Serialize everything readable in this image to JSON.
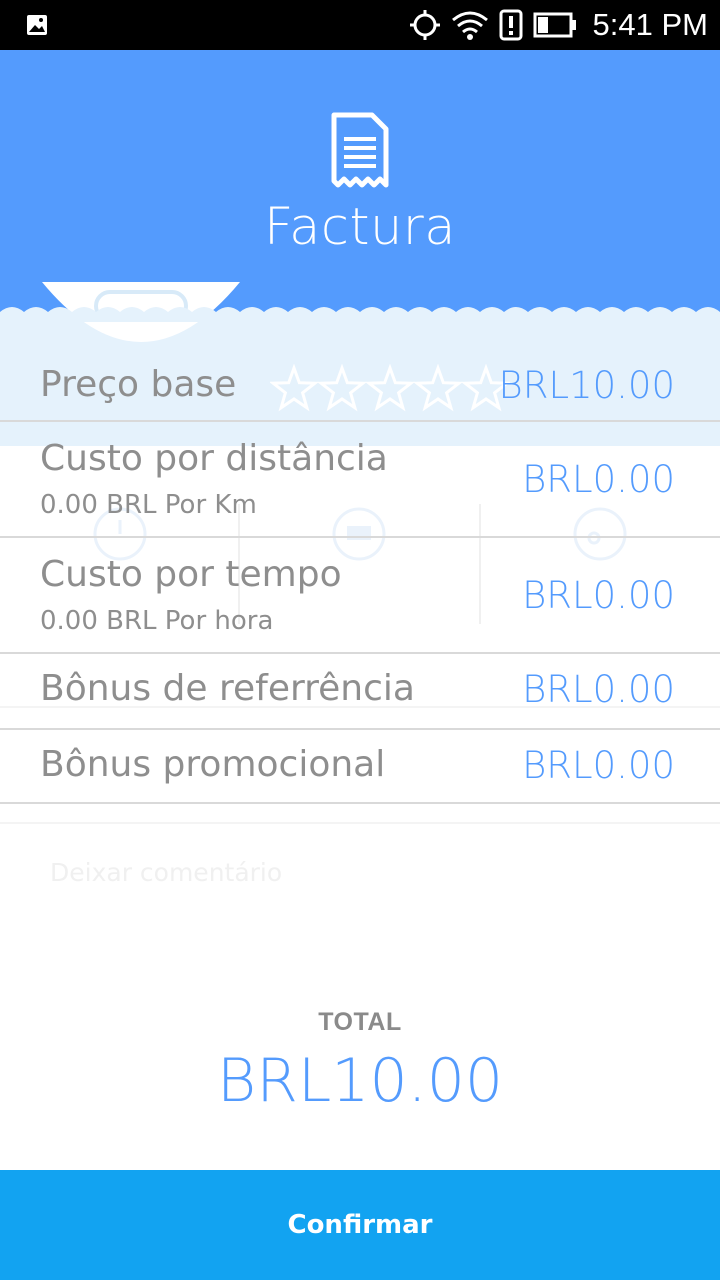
{
  "status_bar": {
    "time": "5:41 PM",
    "icons": [
      "image-icon",
      "gps-icon",
      "wifi-icon",
      "alert-icon",
      "battery-icon"
    ]
  },
  "header": {
    "title": "Factura",
    "icon": "receipt-icon",
    "color": "#549bfd"
  },
  "background": {
    "comment_placeholder": "Deixar comentário"
  },
  "rows": [
    {
      "label": "Preço base",
      "value": "BRL10.00",
      "rating_stars": 5
    },
    {
      "label": "Custo por distância",
      "sub": "0.00 BRL Por Km",
      "value": "BRL0.00"
    },
    {
      "label": "Custo por tempo",
      "sub": "0.00 BRL Por hora",
      "value": "BRL0.00"
    },
    {
      "label": "Bônus de referrência",
      "value": "BRL0.00"
    },
    {
      "label": "Bônus promocional",
      "value": "BRL0.00"
    }
  ],
  "total": {
    "label": "TOTAL",
    "value": "BRL10.00"
  },
  "confirm_button": {
    "label": "Confirmar",
    "color": "#12a3f1"
  }
}
